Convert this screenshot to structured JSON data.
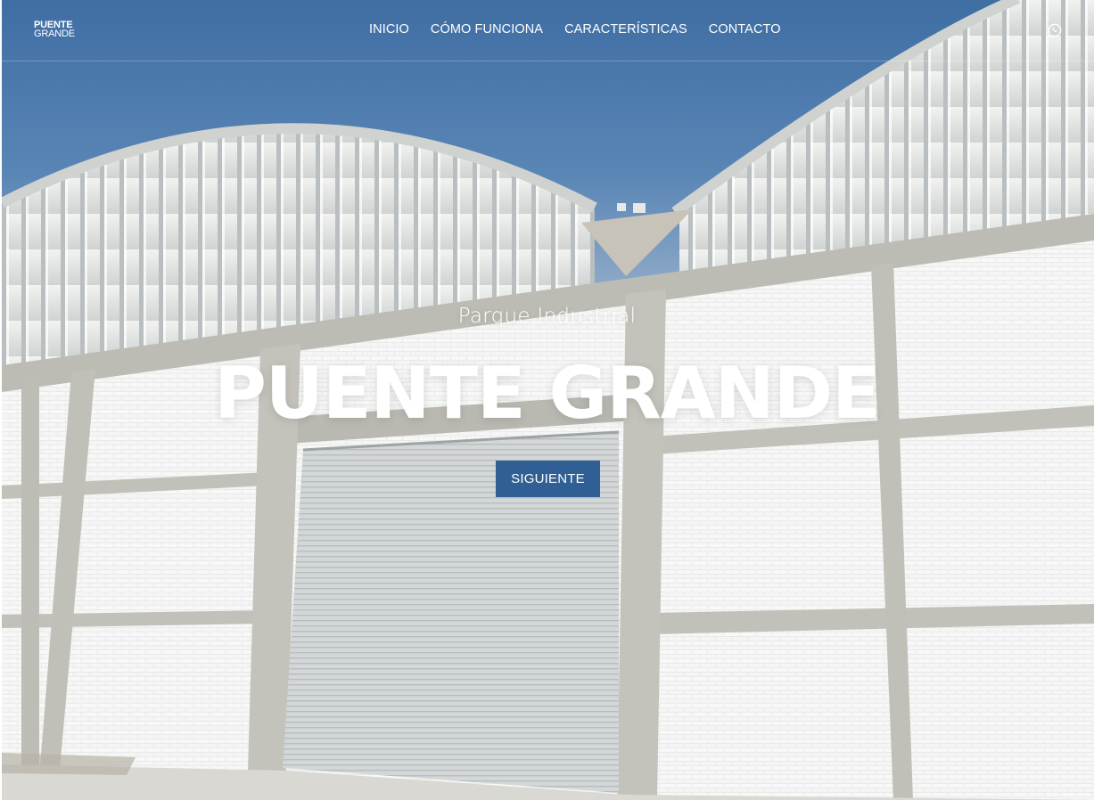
{
  "logo": {
    "line1": "PUENTE",
    "line2": "GRANDE"
  },
  "nav": {
    "items": [
      {
        "label": "INICIO"
      },
      {
        "label": "CÓMO FUNCIONA"
      },
      {
        "label": "CARACTERÍSTICAS"
      },
      {
        "label": "CONTACTO"
      }
    ]
  },
  "header_icons": {
    "whatsapp": "whatsapp-icon"
  },
  "hero": {
    "subtitle": "Parque Industrial",
    "title": "PUENTE GRANDE",
    "cta_label": "SIGUIENTE"
  },
  "colors": {
    "cta_background": "#2f5f94",
    "sky": "#3f6ea3",
    "text": "#ffffff"
  }
}
